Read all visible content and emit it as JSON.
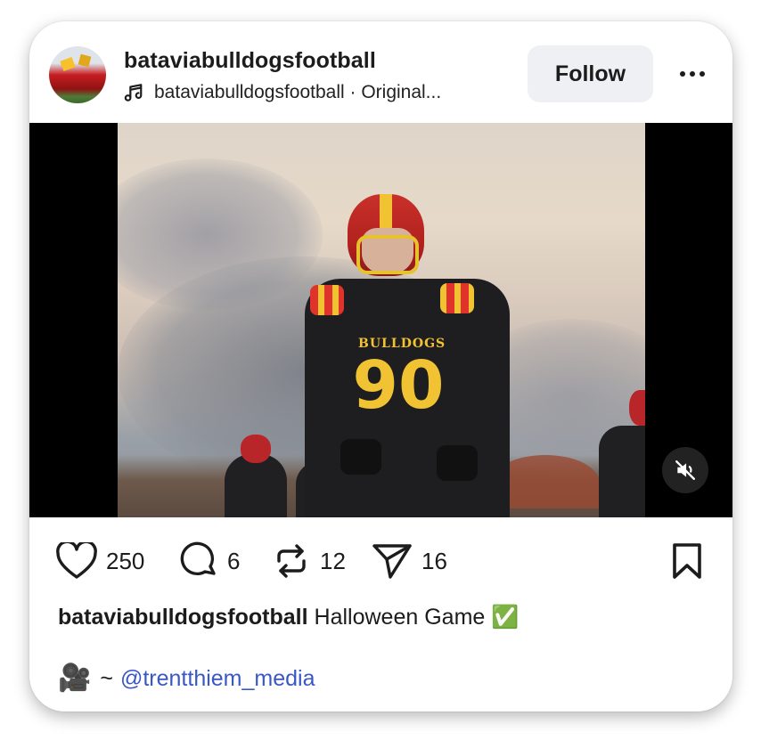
{
  "header": {
    "username": "bataviabulldogsfootball",
    "audio_label": "bataviabulldogsfootball · Original...",
    "follow_label": "Follow",
    "more_icon": "more-horizontal-icon",
    "music_icon": "music-note-icon"
  },
  "media": {
    "jersey_name": "BULLDOGS",
    "jersey_number": "90",
    "mute_icon": "speaker-muted-icon"
  },
  "actions": {
    "likes": "250",
    "comments": "6",
    "reposts": "12",
    "shares": "16"
  },
  "caption": {
    "username": "bataviabulldogsfootball",
    "text": "Halloween Game",
    "emoji": "✅"
  },
  "credit": {
    "emoji": "🎥",
    "separator": "~",
    "mention": "@trentthiem_media"
  },
  "colors": {
    "follow_bg": "#eef0f3",
    "mention": "#3a57c6",
    "text": "#1c1c1c",
    "check_green": "#2fb34a"
  }
}
